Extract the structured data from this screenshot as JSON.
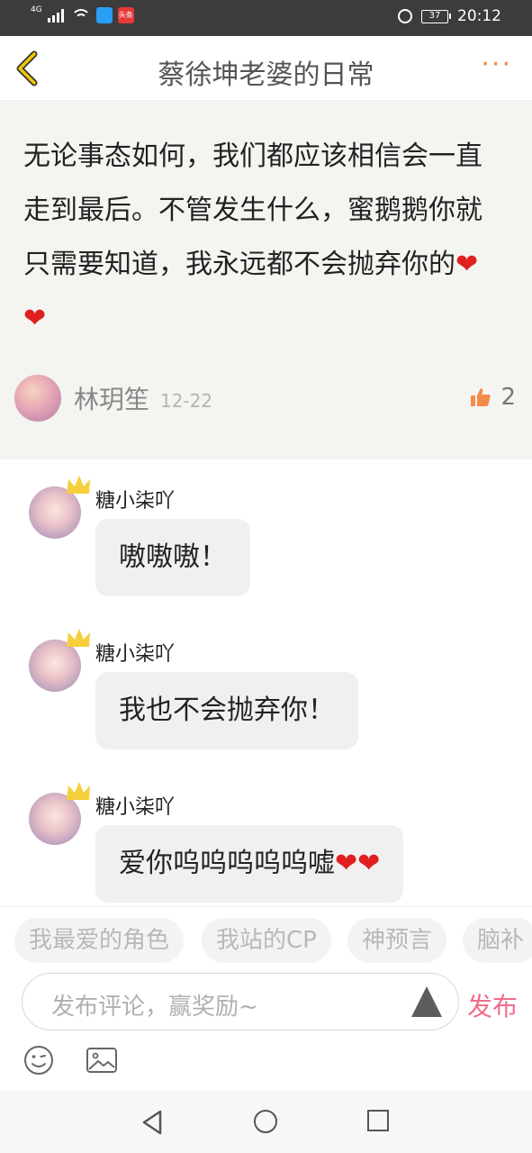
{
  "status_bar": {
    "network": "4G",
    "app_badge": "头条",
    "battery": "37",
    "time": "20:12"
  },
  "header": {
    "title": "蔡徐坤老婆的日常",
    "back_icon": "chevron-left-icon",
    "more_icon": "more-dots-icon"
  },
  "post": {
    "text": "无论事态如何，我们都应该相信会一直走到最后。不管发生什么，蜜鹅鹅你就只需要知道，我永远都不会抛弃你的",
    "hearts": "❤❤",
    "author": "林玥笙",
    "date": "12-22",
    "likes": "2"
  },
  "comments": [
    {
      "name": "糖小柒吖",
      "text": "嗷嗷嗷！"
    },
    {
      "name": "糖小柒吖",
      "text": "我也不会抛弃你！"
    },
    {
      "name": "糖小柒吖",
      "text": "爱你呜呜呜呜呜嘘",
      "hearts": "❤❤"
    }
  ],
  "tags": [
    "我最爱的角色",
    "我站的CP",
    "神预言",
    "脑补"
  ],
  "input": {
    "placeholder": "发布评论，赢奖励~",
    "publish": "发布"
  },
  "colors": {
    "accent": "#f06d8b",
    "more": "#f08b4a",
    "back": "#e0b400"
  }
}
